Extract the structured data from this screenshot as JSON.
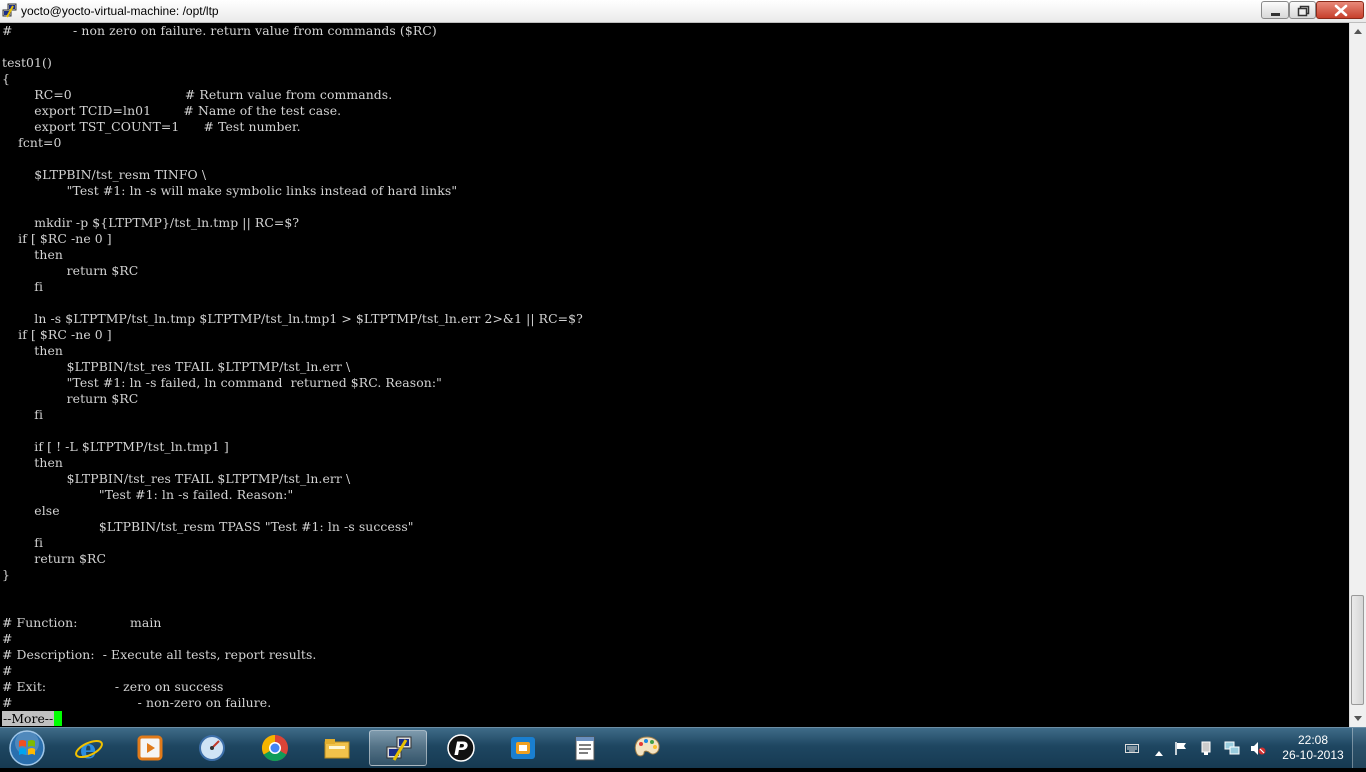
{
  "window": {
    "title": "yocto@yocto-virtual-machine: /opt/ltp",
    "app_icon": "putty-icon",
    "buttons": [
      "minimize-icon",
      "maximize-icon",
      "close-icon"
    ]
  },
  "terminal": {
    "lines": [
      "#               - non zero on failure. return value from commands ($RC)",
      "",
      "test01()",
      "{",
      "        RC=0                            # Return value from commands.",
      "        export TCID=ln01        # Name of the test case.",
      "        export TST_COUNT=1      # Test number.",
      "    fcnt=0",
      "",
      "        $LTPBIN/tst_resm TINFO \\",
      "                \"Test #1: ln -s will make symbolic links instead of hard links\"",
      "",
      "        mkdir -p ${LTPTMP}/tst_ln.tmp || RC=$?",
      "    if [ $RC -ne 0 ]",
      "        then",
      "                return $RC",
      "        fi",
      "",
      "        ln -s $LTPTMP/tst_ln.tmp $LTPTMP/tst_ln.tmp1 > $LTPTMP/tst_ln.err 2>&1 || RC=$?",
      "    if [ $RC -ne 0 ]",
      "        then",
      "                $LTPBIN/tst_res TFAIL $LTPTMP/tst_ln.err \\",
      "                \"Test #1: ln -s failed, ln command  returned $RC. Reason:\"",
      "                return $RC",
      "        fi",
      "",
      "        if [ ! -L $LTPTMP/tst_ln.tmp1 ]",
      "        then",
      "                $LTPBIN/tst_res TFAIL $LTPTMP/tst_ln.err \\",
      "                        \"Test #1: ln -s failed. Reason:\"",
      "        else",
      "                        $LTPBIN/tst_resm TPASS \"Test #1: ln -s success\"",
      "        fi",
      "        return $RC",
      "}",
      "",
      "",
      "# Function:             main",
      "#",
      "# Description:  - Execute all tests, report results.",
      "#",
      "# Exit:                 - zero on success",
      "#                               - non-zero on failure."
    ],
    "pager_prompt": "--More--",
    "colors": {
      "background": "#000000",
      "text": "#d4d4d4",
      "cursor": "#00ff00",
      "prompt_bg": "#c0c0c0"
    }
  },
  "taskbar": {
    "start_icon": "windows-start-orb-icon",
    "pinned": [
      {
        "icon": "internet-explorer-icon",
        "active": false
      },
      {
        "icon": "media-player-icon",
        "active": false
      },
      {
        "icon": "performance-gauge-icon",
        "active": false
      },
      {
        "icon": "chrome-icon",
        "active": false
      },
      {
        "icon": "file-explorer-icon",
        "active": false
      },
      {
        "icon": "putty-icon",
        "active": true
      },
      {
        "icon": "p-app-icon",
        "active": false
      },
      {
        "icon": "virtual-machine-icon",
        "active": false
      },
      {
        "icon": "notepad-icon",
        "active": false
      },
      {
        "icon": "paint-icon",
        "active": false
      }
    ],
    "tray": [
      "keyboard-icon",
      "show-hidden-icons-arrow-icon",
      "action-center-flag-icon",
      "usb-device-icon",
      "network-icon",
      "volume-muted-icon"
    ],
    "clock": {
      "time": "22:08",
      "date": "26-10-2013"
    }
  }
}
